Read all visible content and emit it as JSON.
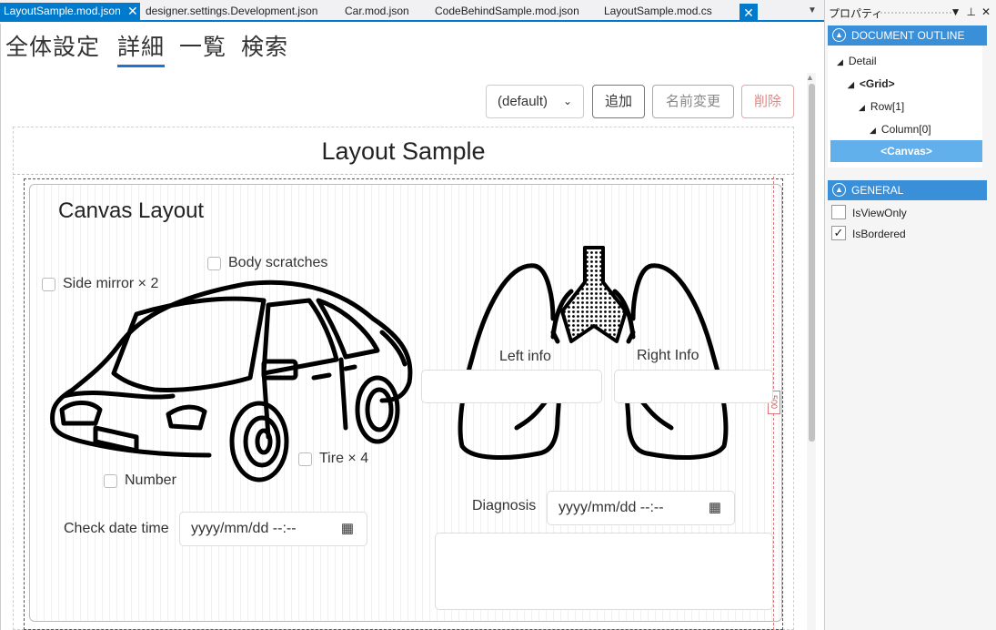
{
  "tabs": [
    {
      "label": "LayoutSample.mod.json",
      "active": true
    },
    {
      "label": "designer.settings.Development.json",
      "active": false
    },
    {
      "label": "Car.mod.json",
      "active": false
    },
    {
      "label": "CodeBehindSample.mod.json",
      "active": false
    },
    {
      "label": "LayoutSample.mod.cs",
      "active": false
    }
  ],
  "nav": [
    "全体設定",
    "詳細",
    "一覧",
    "検索"
  ],
  "toolbar": {
    "layout_select": "(default)",
    "add": "追加",
    "rename": "名前変更",
    "delete": "削除"
  },
  "layout": {
    "title": "Layout Sample",
    "canvas_title": "Canvas Layout",
    "size_tag": "500",
    "car_checks": [
      "Side mirror × 2",
      "Body scratches",
      "Tire × 4",
      "Number"
    ],
    "check_date_label": "Check date time",
    "check_date_placeholder": "yyyy/mm/dd --:--",
    "left_info": "Left info",
    "right_info": "Right Info",
    "diagnosis_label": "Diagnosis",
    "diagnosis_placeholder": "yyyy/mm/dd --:--"
  },
  "properties": {
    "title": "プロパティ",
    "outline_header": "DOCUMENT OUTLINE",
    "tree": [
      "Detail",
      "<Grid>",
      "Row[1]",
      "Column[0]",
      "<Canvas>"
    ],
    "general_header": "GENERAL",
    "props": [
      {
        "label": "IsViewOnly",
        "checked": false
      },
      {
        "label": "IsBordered",
        "checked": true
      }
    ]
  },
  "colors": {
    "accent": "#007acc",
    "section": "#3a8fd9",
    "selected": "#62b0eb"
  }
}
